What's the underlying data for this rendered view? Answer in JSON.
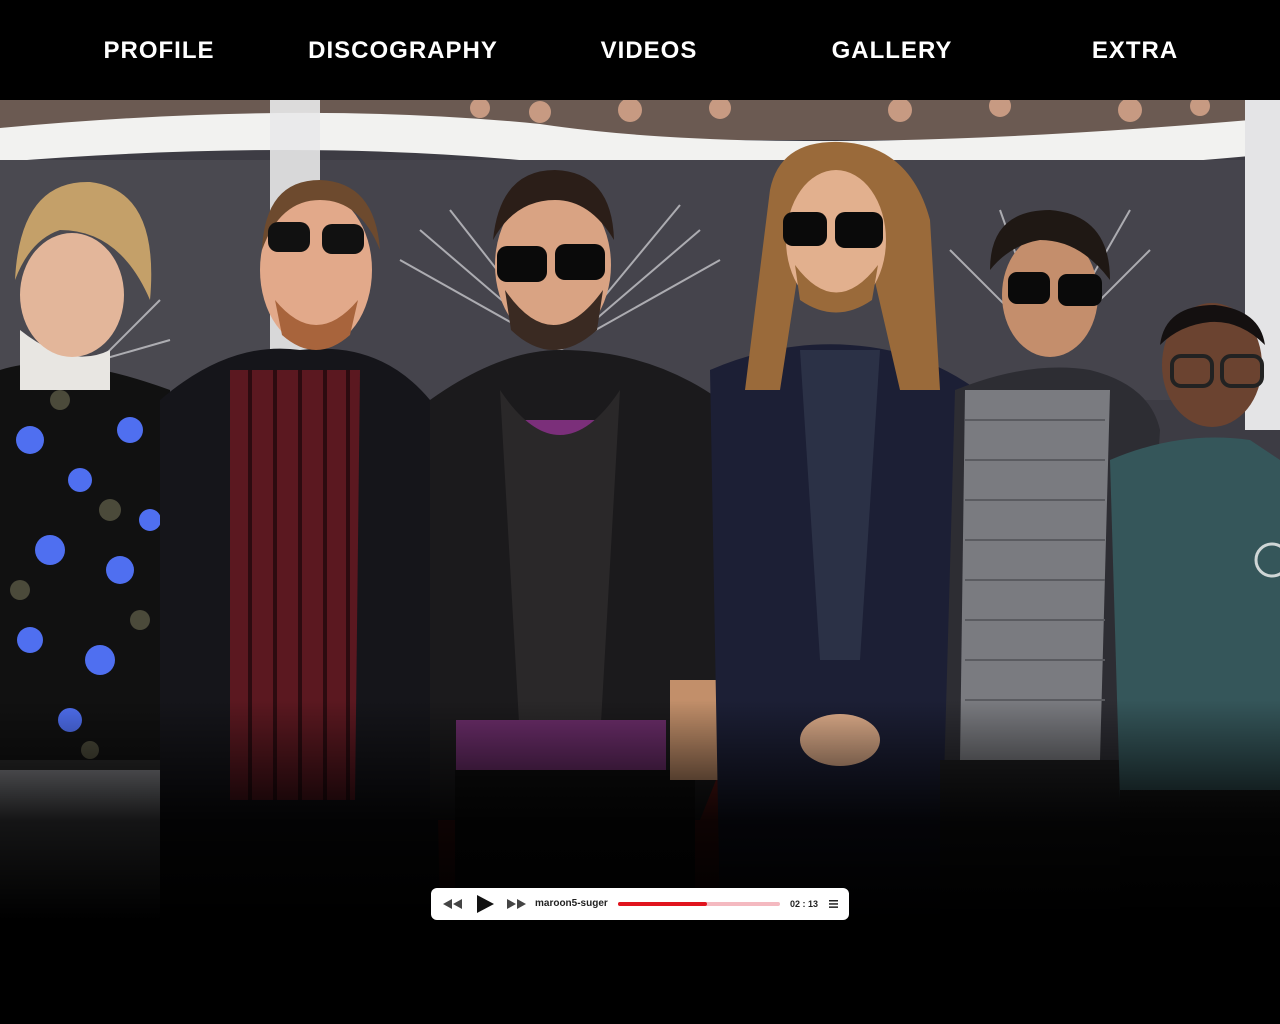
{
  "nav": {
    "items": [
      {
        "label": "PROFILE"
      },
      {
        "label": "DISCOGRAPHY"
      },
      {
        "label": "VIDEOS"
      },
      {
        "label": "GALLERY"
      },
      {
        "label": "EXTRA"
      }
    ]
  },
  "player": {
    "track_title": "maroon5-suger",
    "time": "02 : 13",
    "progress": 0.55,
    "icons": {
      "rewind": "rewind-icon",
      "play": "play-icon",
      "fast_forward": "fast-forward-icon",
      "playlist": "playlist-menu-icon"
    }
  },
  "colors": {
    "nav_background": "#000000",
    "nav_text": "#ffffff",
    "progress_played": "#e0141e",
    "progress_remaining": "#f4b9c0",
    "player_background": "#ffffff"
  }
}
